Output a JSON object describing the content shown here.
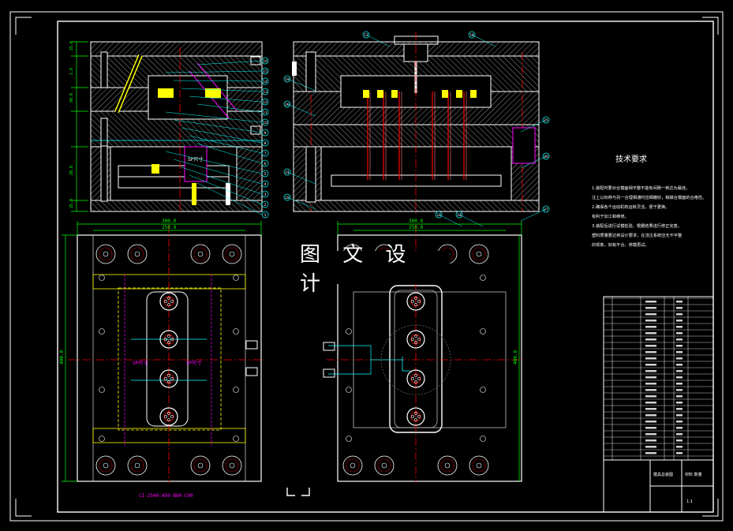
{
  "watermark": "图 文 设 计",
  "tech_requirements": {
    "title": "技术要求",
    "items": [
      "1.装配时要对合模面相平整不能有间隙一到达为最佳。",
      "注上以标称与另一合理相通时应细磨好，稍做合模面的合格性。",
      "2.确保各个运动机构运转灵活，便于更换。",
      "有利于加工和维修。",
      "3.装配后进行试模检验，根据结果进行修正完善。",
      "塑料质量要达到设计要求，在浇注系统应无不平整",
      "的现象，如有不合，修模再试。"
    ]
  },
  "mold_base_label": "CI-2540-A50-B60-C90",
  "dimensions": {
    "left_width_outer": "300.0",
    "left_width_inner": "250.0",
    "right_width_outer": "300.0",
    "right_width_inner": "250.0",
    "left_height": "400.0",
    "right_height": "400.0"
  },
  "part_labels": {
    "sp_section": "SP尺寸",
    "sp_left": "SP尺寸",
    "sp_right": "SP尺寸"
  },
  "section_dims": [
    "25.0",
    "",
    "1.0",
    "",
    "90.0",
    "",
    "20.0",
    "",
    "25.0"
  ],
  "callouts_left": [
    "1",
    "2",
    "3",
    "4",
    "5",
    "6",
    "7",
    "8",
    "9",
    "10",
    "11",
    "12",
    "13",
    "14",
    "15",
    "16"
  ],
  "callouts_right": [
    "17",
    "18",
    "19",
    "20",
    "21",
    "22",
    "23",
    "24",
    "25",
    "26",
    "27"
  ],
  "title_block": {
    "drawing_name": "模具总装图",
    "company": "材料 数量",
    "sheet": "1:1"
  },
  "colors": {
    "line": "#ffffff",
    "dim": "#00ff00",
    "hidden": "#ffff00",
    "center": "#ff0000",
    "cyan": "#00ffff",
    "magenta": "#ff00ff",
    "hatch": "#c0c0c0"
  }
}
